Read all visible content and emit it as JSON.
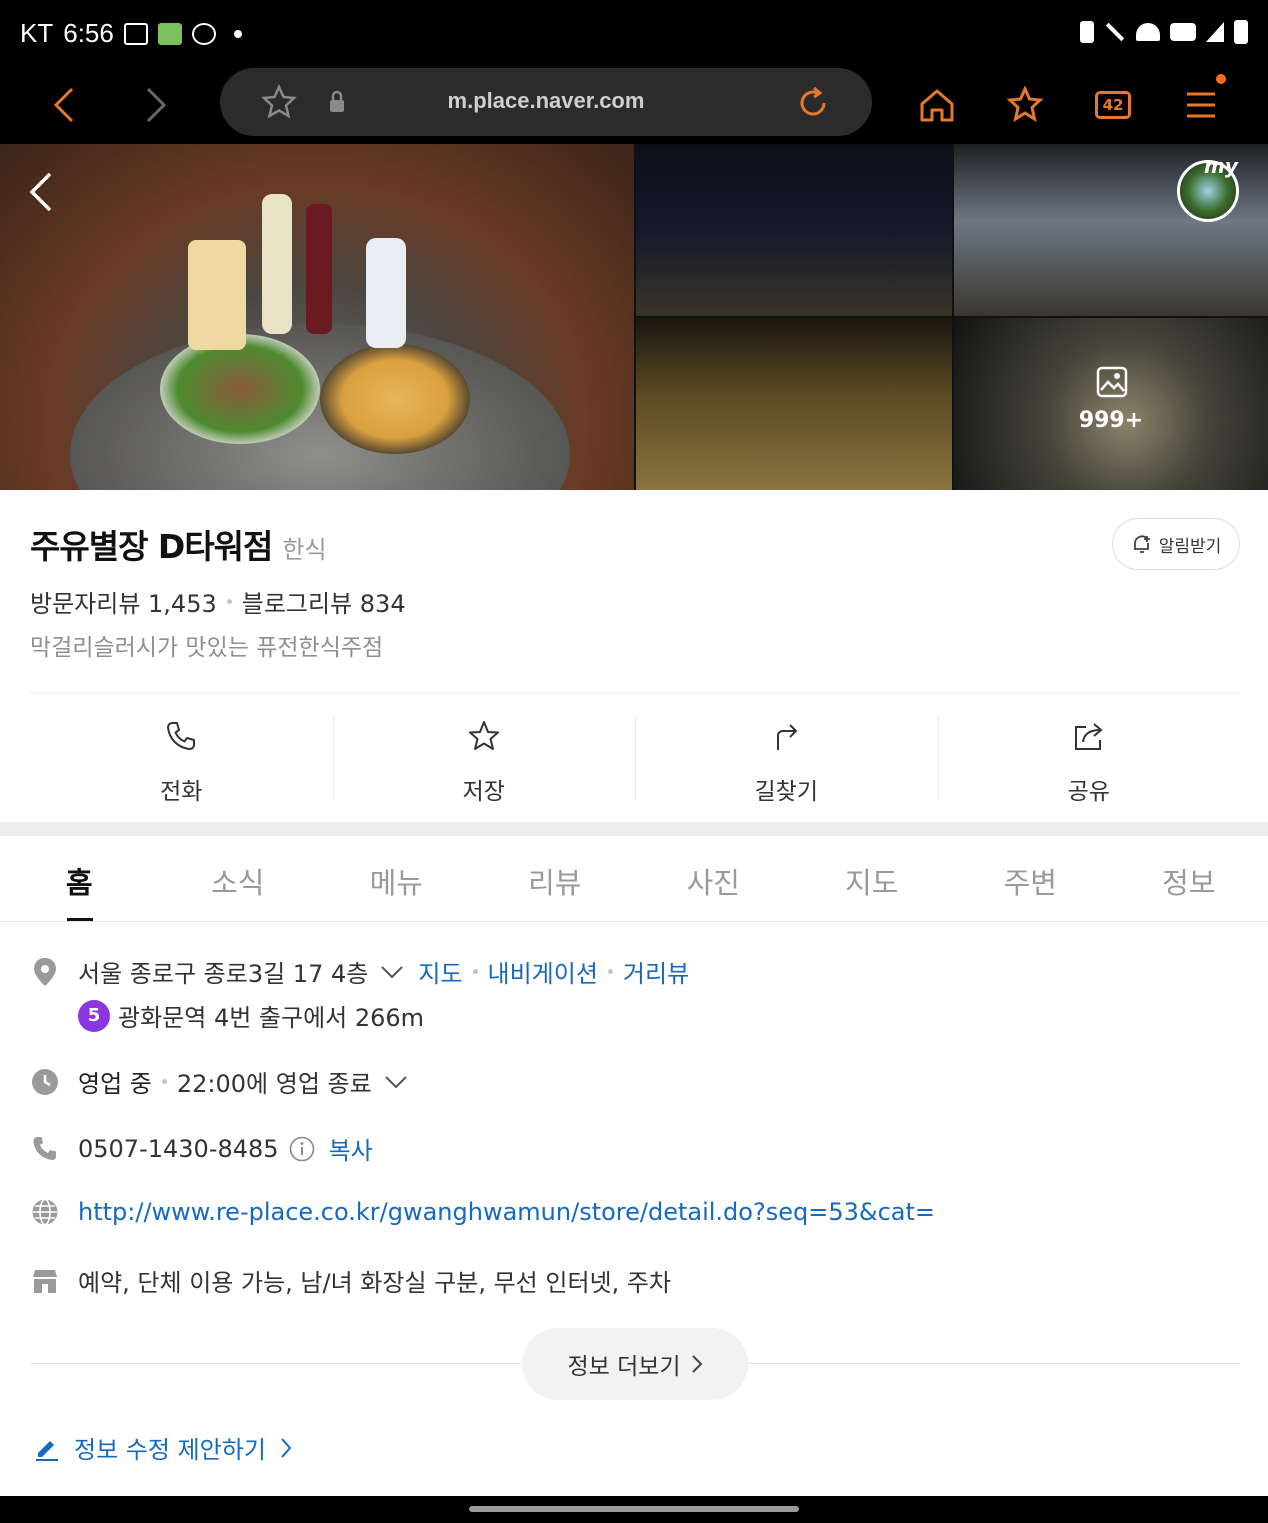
{
  "status_bar": {
    "carrier": "KT",
    "time": "6:56"
  },
  "browser": {
    "url": "m.place.naver.com",
    "tab_count": "42"
  },
  "gallery": {
    "photo_count": "999+",
    "my_badge": "my"
  },
  "place": {
    "name": "주유별장 D타워점",
    "category": "한식",
    "alarm_label": "알림받기",
    "visitor_reviews": "방문자리뷰 1,453",
    "blog_reviews": "블로그리뷰 834",
    "description": "막걸리슬러시가 맛있는 퓨전한식주점"
  },
  "actions": [
    {
      "label": "전화",
      "icon": "phone-icon"
    },
    {
      "label": "저장",
      "icon": "star-icon"
    },
    {
      "label": "길찾기",
      "icon": "directions-icon"
    },
    {
      "label": "공유",
      "icon": "share-icon"
    }
  ],
  "tabs": [
    "홈",
    "소식",
    "메뉴",
    "리뷰",
    "사진",
    "지도",
    "주변",
    "정보"
  ],
  "info": {
    "address": "서울 종로구 종로3길 17 4층",
    "map_link": "지도",
    "nav_link": "내비게이션",
    "street_link": "거리뷰",
    "subway_line": "5",
    "subway_text": "광화문역 4번 출구에서 266m",
    "hours_status": "영업 중",
    "hours_text": "22:00에 영업 종료",
    "phone": "0507-1430-8485",
    "copy_label": "복사",
    "website": "http://www.re-place.co.kr/gwanghwamun/store/detail.do?seq=53&cat=",
    "amenities": "예약, 단체 이용 가능, 남/녀 화장실 구분, 무선 인터넷, 주차"
  },
  "more_info_label": "정보 더보기",
  "suggest_label": "정보 수정 제안하기",
  "colors": {
    "link": "#1569c0",
    "subway_line5": "#8936e0",
    "accent_dot": "#ff6a1a"
  }
}
